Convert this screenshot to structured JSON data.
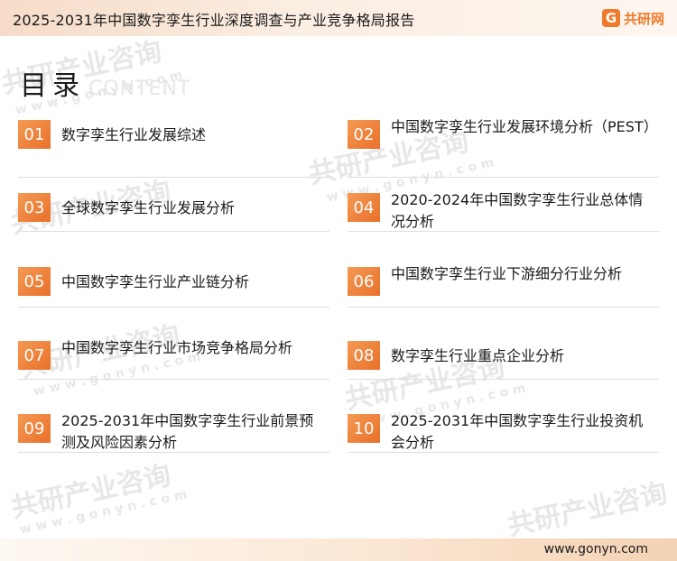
{
  "header": {
    "title": "2025-2031年中国数字孪生行业深度调查与产业竞争格局报告",
    "brand": {
      "mark": "G",
      "name": "共研网",
      "color": "#ef7a2c"
    }
  },
  "heading": {
    "main": "目录",
    "sub": "CONTENT"
  },
  "watermark": {
    "brand": "共研产业咨询",
    "url": "w w w . g o n y n . c o m"
  },
  "toc": [
    {
      "num": "01",
      "label": "数字孪生行业发展综述"
    },
    {
      "num": "02",
      "label": "中国数字孪生行业发展环境分析（PEST）"
    },
    {
      "num": "03",
      "label": "全球数字孪生行业发展分析"
    },
    {
      "num": "04",
      "label": "2020-2024年中国数字孪生行业总体情况分析"
    },
    {
      "num": "05",
      "label": "中国数字孪生行业产业链分析"
    },
    {
      "num": "06",
      "label": "中国数字孪生行业下游细分行业分析"
    },
    {
      "num": "07",
      "label": "中国数字孪生行业市场竞争格局分析"
    },
    {
      "num": "08",
      "label": "数字孪生行业重点企业分析"
    },
    {
      "num": "09",
      "label": "2025-2031年中国数字孪生行业前景预测及风险因素分析"
    },
    {
      "num": "10",
      "label": "2025-2031年中国数字孪生行业投资机会分析"
    }
  ],
  "footer": {
    "url": "www.gonyn.com"
  },
  "colors": {
    "accent": "#ef7a2c",
    "badge_light": "#f39a54",
    "line": "#dddddd"
  }
}
